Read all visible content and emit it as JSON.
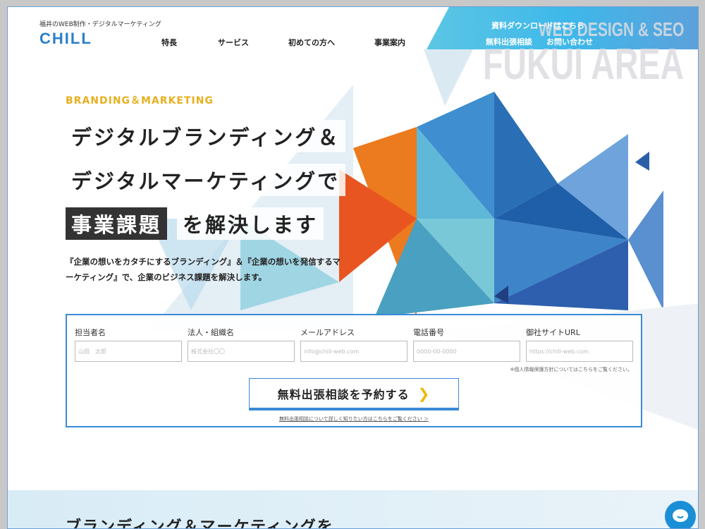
{
  "header": {
    "tagline": "福井のWEB制作・デジタルマーケティング",
    "logo": "CHILL",
    "nav": [
      "特長",
      "サービス",
      "初めての方へ",
      "事業案内"
    ],
    "download": "資料ダウンロードはこちら",
    "consult": "無料出張相談",
    "contact": "お問い合わせ",
    "watermark_1": "WEB DESIGN & SEO",
    "watermark_2": "FUKUI AREA"
  },
  "hero": {
    "eyebrow": "BRANDING＆MARKETING",
    "line1": "デジタルブランディング＆",
    "line2": "デジタルマーケティングで",
    "line3a": "事業課題",
    "line3b": "を解決します",
    "lead": "『企業の想いをカタチにするブランディング』＆『企業の想いを発信するマーケティング』で、企業のビジネス課題を解決します。"
  },
  "form": {
    "fields": [
      {
        "label": "担当者名",
        "placeholder": "山田　太郎"
      },
      {
        "label": "法人・組織名",
        "placeholder": "株式会社〇〇"
      },
      {
        "label": "メールアドレス",
        "placeholder": "info@chill-web.com"
      },
      {
        "label": "電話番号",
        "placeholder": "0000-00-0000"
      },
      {
        "label": "御社サイトURL",
        "placeholder": "https://chill-web.com"
      }
    ],
    "privacy": "※個人情報保護方針についてはこちらをご覧ください。",
    "submit": "無料出張相談を予約する",
    "more": "無料出張相談について詳しく知りたい方はこちらをご覧ください ＞"
  },
  "section": {
    "heading": "ブランディング＆マーケティングを"
  },
  "colors": {
    "accent": "#2a7fc8",
    "yellow": "#e8b020",
    "orange": "#ec6a1e"
  }
}
